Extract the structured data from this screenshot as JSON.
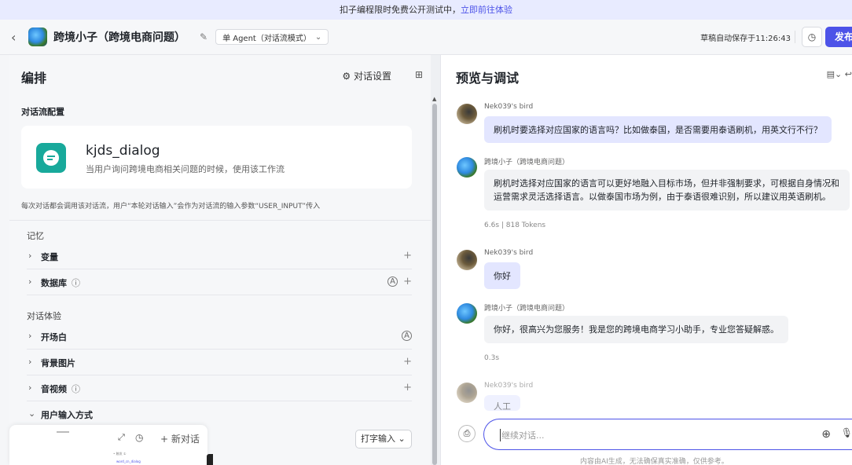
{
  "banner": {
    "text": "扣子编程限时免费公开测试中，",
    "link": "立即前往体验"
  },
  "header": {
    "back_icon": "chevron-left-icon",
    "bot_name": "跨境小子（跨境电商问题）",
    "mode_label": "单 Agent（对话流模式）",
    "save_status": "草稿自动保存于11:26:43",
    "publish_label": "发布"
  },
  "left": {
    "title": "编排",
    "settings_label": "对话设置",
    "workflow_section": "对话流配置",
    "workflow": {
      "name": "kjds_dialog",
      "desc": "当用户询问跨境电商相关问题的时候，使用该工作流"
    },
    "note": "每次对话都会调用该对话流，用户“本轮对话输入”会作为对话流的输入参数“USER_INPUT”传入",
    "memory_group": "记忆",
    "memory_items": [
      "变量",
      "数据库"
    ],
    "experience_group": "对话体验",
    "experience_items": [
      "开场白",
      "背景图片",
      "音视频",
      "用户输入方式"
    ],
    "input_mode": "打字输入"
  },
  "mini_panel": {
    "new_chat": "+ 新对话",
    "tiny1": "• 触发 ①",
    "tiny2": "word_cn_dialog"
  },
  "right": {
    "title": "预览与调试",
    "messages": [
      {
        "role": "user",
        "name": "Nek039's bird",
        "text": "刷机时要选择对应国家的语言吗？比如做泰国，是否需要用泰语刷机，用英文行不行？"
      },
      {
        "role": "bot",
        "name": "跨境小子（跨境电商问题）",
        "line1": "刷机时选择对应国家的语言可以更好地融入目标市场，但并非强制要求，可根据自身情况和",
        "line2": "运营需求灵活选择语言。以做泰国市场为例，由于泰语很难识别，所以建议用英语刷机。",
        "meta": "6.6s | 818 Tokens"
      },
      {
        "role": "user",
        "name": "Nek039's bird",
        "text": "你好"
      },
      {
        "role": "bot",
        "name": "跨境小子（跨境电商问题）",
        "text": "你好，很高兴为您服务！我是您的跨境电商学习小助手，专业您答疑解惑。",
        "meta": "0.3s"
      },
      {
        "role": "user",
        "name": "Nek039's bird",
        "text": "人工"
      }
    ],
    "input_placeholder": "继续对话...",
    "disclaimer": "内容由AI生成，无法确保真实准确，仅供参考。"
  }
}
